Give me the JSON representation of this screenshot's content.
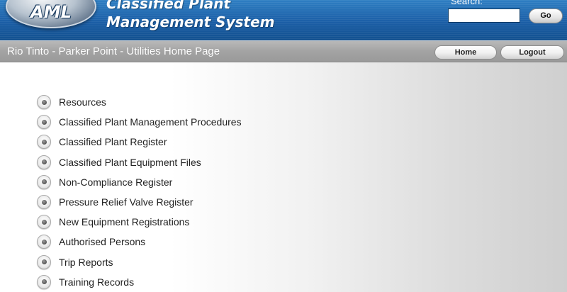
{
  "header": {
    "logo_text": "AML",
    "title_line1": "Classified Plant",
    "title_line2": "Management System",
    "search_label": "Search:",
    "search_value": "",
    "go_label": "Go"
  },
  "navbar": {
    "page_title": "Rio Tinto - Parker Point - Utilities Home Page",
    "home_label": "Home",
    "logout_label": "Logout"
  },
  "menu": {
    "items": [
      {
        "label": "Resources"
      },
      {
        "label": "Classified Plant Management Procedures"
      },
      {
        "label": "Classified Plant Register"
      },
      {
        "label": "Classified Plant Equipment Files"
      },
      {
        "label": "Non-Compliance Register"
      },
      {
        "label": "Pressure Relief Valve Register"
      },
      {
        "label": "New Equipment Registrations"
      },
      {
        "label": "Authorised Persons"
      },
      {
        "label": "Trip Reports"
      },
      {
        "label": "Training Records"
      }
    ]
  },
  "colors": {
    "header_blue": "#1b5ea6",
    "navbar_gray": "#a3a3a3",
    "text": "#222222"
  }
}
